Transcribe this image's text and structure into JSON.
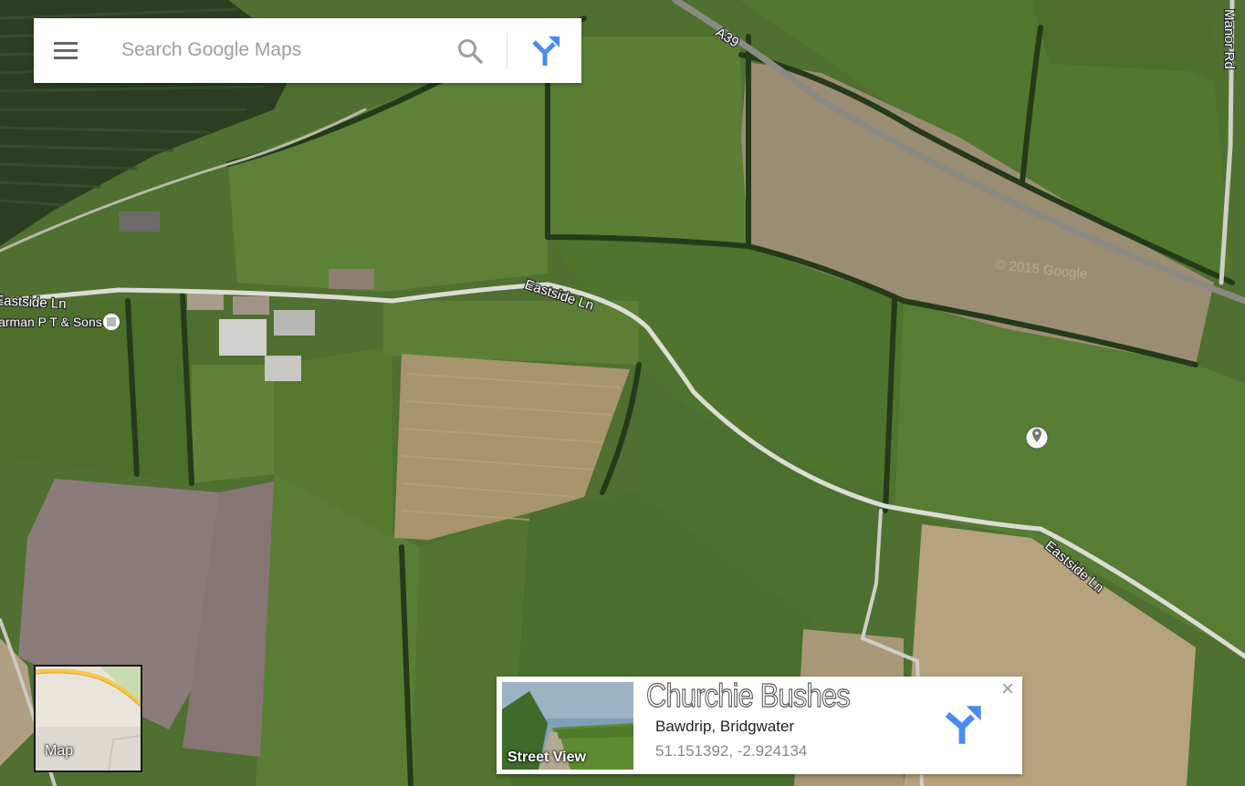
{
  "search": {
    "placeholder": "Search Google Maps"
  },
  "icons": {
    "menu": "hamburger-menu-icon",
    "search": "magnifier-icon",
    "directions": "directions-arrow-icon",
    "place_pin": "place-pin-icon",
    "poi": "poi-square-icon",
    "close": "close-x-icon"
  },
  "map": {
    "view": "satellite",
    "road_labels": {
      "a39": "A39",
      "manor_rd": "Manor Rd",
      "eastside_ln_left": "Eastside Ln",
      "eastside_ln_mid": "Eastside Ln",
      "eastside_ln_right": "Eastside Ln"
    },
    "poi_label": "Harman P T & Sons",
    "watermark": "© 2015 Google"
  },
  "minimap": {
    "label": "Map"
  },
  "info_card": {
    "name": "Churchie Bushes",
    "locality": "Bawdrip, Bridgwater",
    "coordinates": "51.151392, -2.924134",
    "street_view_label": "Street View",
    "close_symbol": "×"
  },
  "colors": {
    "directions_blue": "#4a8af4",
    "field_green": "#5b7d35",
    "field_dark": "#3f5e26",
    "field_tan": "#b2a07c",
    "field_mauve": "#8c7c7a"
  }
}
